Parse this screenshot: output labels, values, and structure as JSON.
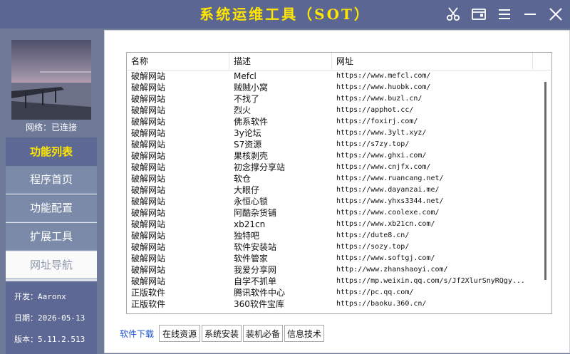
{
  "window": {
    "title": "系统运维工具（SOT）",
    "buttons": [
      "scissors-icon",
      "window-icon",
      "menu-icon",
      "minimize-icon",
      "close-icon"
    ]
  },
  "sidebar": {
    "network_status": "网络：已连接",
    "menu_title": "功能列表",
    "items": [
      {
        "label": "程序首页"
      },
      {
        "label": "功能配置"
      },
      {
        "label": "扩展工具"
      },
      {
        "label": "网址导航",
        "active": true
      }
    ],
    "info": {
      "developer": "开发：Aaronx",
      "date": "日期：2026-05-13",
      "version": "版本：5.11.2.513"
    }
  },
  "table": {
    "columns": [
      "名称",
      "描述",
      "网址"
    ],
    "rows": [
      {
        "name": "破解网站",
        "desc": "Mefcl",
        "url": "https://www.mefcl.com/"
      },
      {
        "name": "破解网站",
        "desc": "贼贼小窝",
        "url": "https://www.huobk.com/"
      },
      {
        "name": "破解网站",
        "desc": "不找了",
        "url": "https://www.buzl.cn/"
      },
      {
        "name": "破解网站",
        "desc": "烈火",
        "url": "https://apphot.cc/"
      },
      {
        "name": "破解网站",
        "desc": "佛系软件",
        "url": "https://foxirj.com/"
      },
      {
        "name": "破解网站",
        "desc": "3y论坛",
        "url": "https://www.3ylt.xyz/"
      },
      {
        "name": "破解网站",
        "desc": "S7资源",
        "url": "https://s7zy.top/"
      },
      {
        "name": "破解网站",
        "desc": "果核剥壳",
        "url": "https://www.ghxi.com/"
      },
      {
        "name": "破解网站",
        "desc": "初念撑分享站",
        "url": "https://www.cnjfx.com/"
      },
      {
        "name": "破解网站",
        "desc": "软仓",
        "url": "https://www.ruancang.net/"
      },
      {
        "name": "破解网站",
        "desc": "大眼仔",
        "url": "https://www.dayanzai.me/"
      },
      {
        "name": "破解网站",
        "desc": "永恒心锁",
        "url": "https://www.yhxs3344.net/"
      },
      {
        "name": "破解网站",
        "desc": "阿酷杂货铺",
        "url": "https://www.coolexe.com/"
      },
      {
        "name": "破解网站",
        "desc": "xb21cn",
        "url": "https://www.xb21cn.com/"
      },
      {
        "name": "破解网站",
        "desc": "独特吧",
        "url": "https://dute8.cn/"
      },
      {
        "name": "破解网站",
        "desc": "软件安装站",
        "url": "https://sozy.top/"
      },
      {
        "name": "破解网站",
        "desc": "软件管家",
        "url": "https://www.softgj.com/"
      },
      {
        "name": "破解网站",
        "desc": "我爱分享网",
        "url": "http://www.zhanshaoyi.com/"
      },
      {
        "name": "破解网站",
        "desc": "自学不抓单",
        "url": "https://mp.weixin.qq.com/s/Jf2XlurSnyRQgy..."
      },
      {
        "name": "正版软件",
        "desc": "腾讯软件中心",
        "url": "https://pc.qq.com/"
      },
      {
        "name": "正版软件",
        "desc": "360软件宝库",
        "url": "https://baoku.360.cn/"
      }
    ]
  },
  "tabs": [
    {
      "label": "软件下载",
      "active": true
    },
    {
      "label": "在线资源"
    },
    {
      "label": "系统安装"
    },
    {
      "label": "装机必备"
    },
    {
      "label": "信息技术"
    }
  ]
}
